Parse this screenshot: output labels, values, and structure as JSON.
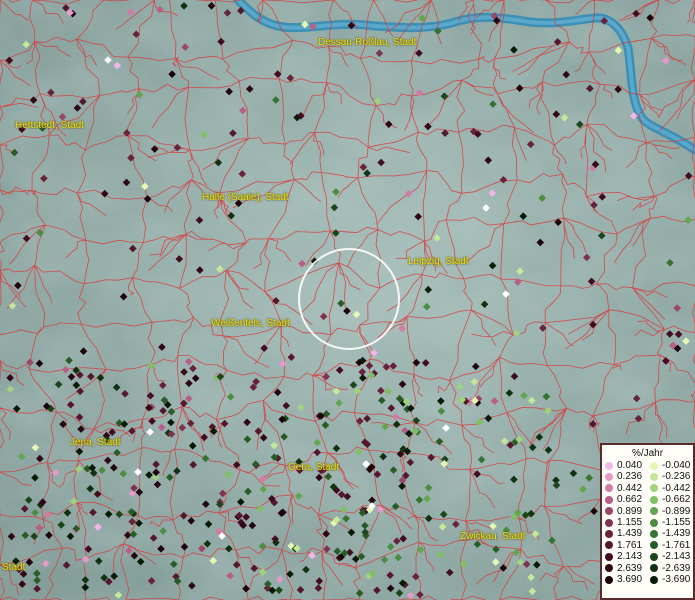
{
  "legend": {
    "title": "%/Jahr",
    "positive": [
      {
        "label": "0.040",
        "color": "#f3b6ea"
      },
      {
        "label": "0.236",
        "color": "#e69ac9"
      },
      {
        "label": "0.442",
        "color": "#d27ba7"
      },
      {
        "label": "0.662",
        "color": "#b85f87"
      },
      {
        "label": "0.899",
        "color": "#9a4668"
      },
      {
        "label": "1.155",
        "color": "#7e3450"
      },
      {
        "label": "1.439",
        "color": "#68233b"
      },
      {
        "label": "1.761",
        "color": "#55172d"
      },
      {
        "label": "2.143",
        "color": "#420c20"
      },
      {
        "label": "2.639",
        "color": "#300514"
      },
      {
        "label": "3.690",
        "color": "#1e020b"
      }
    ],
    "negative": [
      {
        "label": "-0.040",
        "color": "#e4f7b3"
      },
      {
        "label": "-0.236",
        "color": "#c4e89a"
      },
      {
        "label": "-0.442",
        "color": "#9fd37e"
      },
      {
        "label": "-0.662",
        "color": "#7fbf66"
      },
      {
        "label": "-0.899",
        "color": "#62a651"
      },
      {
        "label": "-1.155",
        "color": "#4c8d41"
      },
      {
        "label": "-1.439",
        "color": "#377232"
      },
      {
        "label": "-1.761",
        "color": "#275c26"
      },
      {
        "label": "-2.143",
        "color": "#1a4619"
      },
      {
        "label": "-2.639",
        "color": "#0f3210"
      },
      {
        "label": "-3.690",
        "color": "#051a05"
      }
    ]
  },
  "cities": [
    {
      "id": "dessau",
      "label": "Dessau-Roßlau, Stadt"
    },
    {
      "id": "hettstedt",
      "label": "Hettstedt, Stadt"
    },
    {
      "id": "halle",
      "label": "Halle (Saale), Stadt"
    },
    {
      "id": "leipzig",
      "label": "Leipzig, Stadt"
    },
    {
      "id": "weissenfels",
      "label": "Weißenfels, Stadt"
    },
    {
      "id": "jena",
      "label": "Jena, Stadt"
    },
    {
      "id": "gera",
      "label": "Gera, Stadt"
    },
    {
      "id": "zwickau",
      "label": "Zwickau, Stadt"
    },
    {
      "id": "stadt-sw",
      "label": "Stadt"
    }
  ],
  "colors": {
    "terrain": "#8fa8a4",
    "river": "#3d8fb4",
    "borders": "#d8383a",
    "city_label": "#f4e21a",
    "selection_circle": "#ffffff"
  }
}
